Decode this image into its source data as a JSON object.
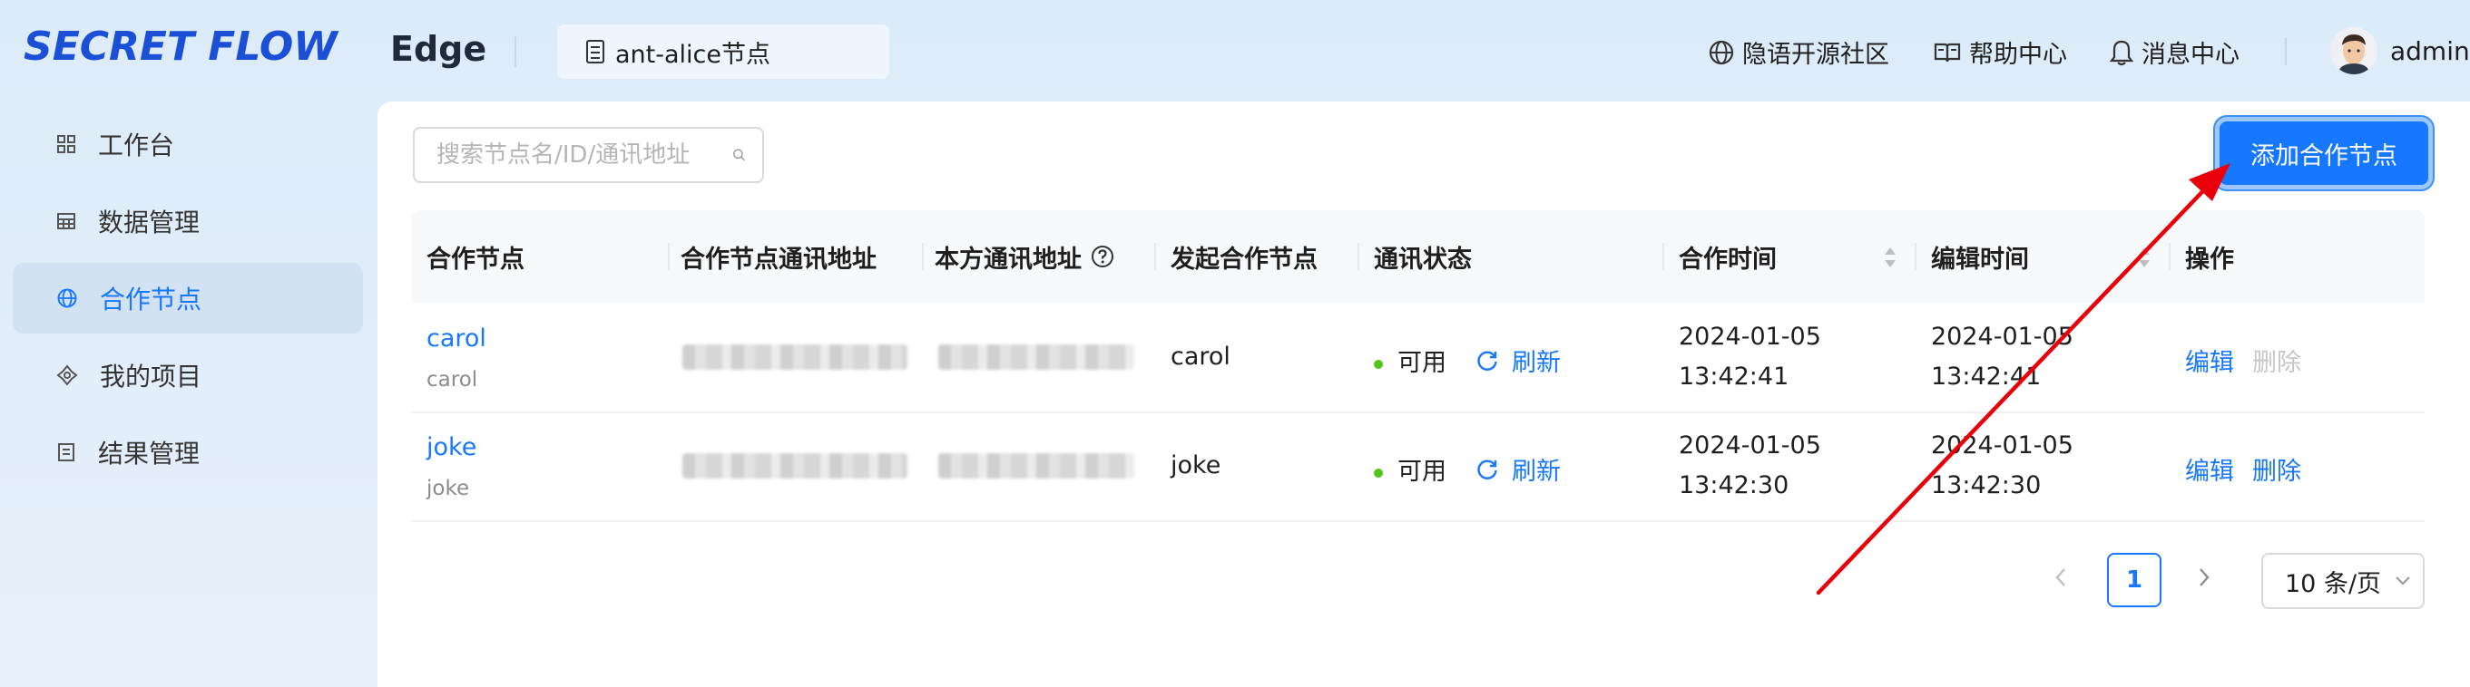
{
  "brand": {
    "logo_text": "SECRET FLOW",
    "app_title": "Edge"
  },
  "header": {
    "node_selector": "ant-alice节点",
    "links": [
      {
        "label": "隐语开源社区",
        "icon": "globe-icon"
      },
      {
        "label": "帮助中心",
        "icon": "book-icon"
      },
      {
        "label": "消息中心",
        "icon": "bell-icon"
      }
    ],
    "username": "admin"
  },
  "sidebar": {
    "items": [
      {
        "label": "工作台",
        "icon": "dashboard-icon",
        "active": false
      },
      {
        "label": "数据管理",
        "icon": "table-icon",
        "active": false
      },
      {
        "label": "合作节点",
        "icon": "globe-icon",
        "active": true
      },
      {
        "label": "我的项目",
        "icon": "project-icon",
        "active": false
      },
      {
        "label": "结果管理",
        "icon": "result-icon",
        "active": false
      }
    ]
  },
  "toolbar": {
    "search_placeholder": "搜索节点名/ID/通讯地址",
    "add_button": "添加合作节点"
  },
  "table": {
    "columns": [
      "合作节点",
      "合作节点通讯地址",
      "本方通讯地址",
      "发起合作节点",
      "通讯状态",
      "合作时间",
      "编辑时间",
      "操作"
    ],
    "rows": [
      {
        "node_name": "carol",
        "node_id": "carol",
        "initiator": "carol",
        "status": "可用",
        "refresh": "刷新",
        "coop_date": "2024-01-05",
        "coop_time": "13:42:41",
        "edit_date": "2024-01-05",
        "edit_time": "13:42:41",
        "action_edit": "编辑",
        "action_delete": "删除",
        "delete_enabled": false
      },
      {
        "node_name": "joke",
        "node_id": "joke",
        "initiator": "joke",
        "status": "可用",
        "refresh": "刷新",
        "coop_date": "2024-01-05",
        "coop_time": "13:42:30",
        "edit_date": "2024-01-05",
        "edit_time": "13:42:30",
        "action_edit": "编辑",
        "action_delete": "删除",
        "delete_enabled": true
      }
    ]
  },
  "pagination": {
    "current_page": "1",
    "page_size": "10 条/页"
  },
  "colors": {
    "primary": "#1677ff",
    "status_ok": "#52c41a",
    "annotation": "#e8000b"
  }
}
